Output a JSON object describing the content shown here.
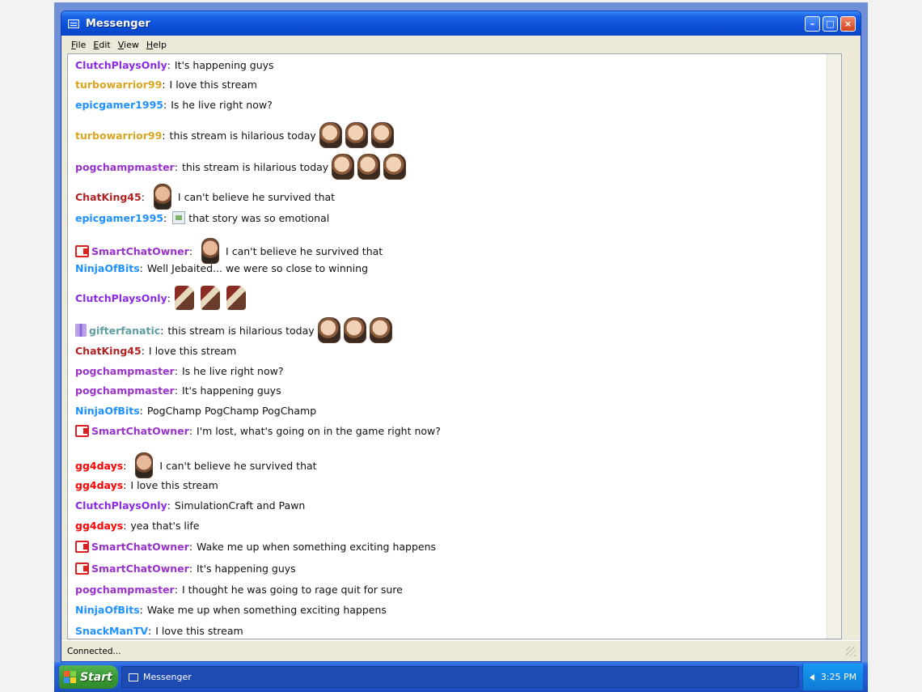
{
  "window": {
    "title": "Messenger"
  },
  "menu": [
    {
      "label": "File",
      "key": "F",
      "rest": "ile"
    },
    {
      "label": "Edit",
      "key": "E",
      "rest": "dit"
    },
    {
      "label": "View",
      "key": "V",
      "rest": "iew"
    },
    {
      "label": "Help",
      "key": "H",
      "rest": "elp"
    }
  ],
  "messages": [
    {
      "user": "ClutchPlaysOnly",
      "color": "#8a2be2",
      "text": "It's happening guys"
    },
    {
      "user": "turbowarrior99",
      "color": "#daa520",
      "text": "I love this stream"
    },
    {
      "user": "epicgamer1995",
      "color": "#1e90ff",
      "text": "Is he live right now?"
    },
    {
      "user": "turbowarrior99",
      "color": "#daa520",
      "text": "this stream is hilarious today",
      "emotes": 3
    },
    {
      "user": "pogchampmaster",
      "color": "#9932cc",
      "text": "this stream is hilarious today",
      "emotes": 3
    },
    {
      "user": "ChatKing45",
      "color": "#b22222",
      "text": "I can't believe he survived that",
      "face": true
    },
    {
      "user": "epicgamer1995",
      "color": "#1e90ff",
      "text": "that story was so emotional",
      "broken_img": true
    },
    {
      "user": "SmartChatOwner",
      "color": "#9932cc",
      "text": "I can't believe he survived that",
      "badge": "cam",
      "face": true
    },
    {
      "user": "NinjaOfBits",
      "color": "#1e90ff",
      "text": "Well Jebaited... we were so close to winning"
    },
    {
      "user": "ClutchPlaysOnly",
      "color": "#8a2be2",
      "text": "",
      "dinos": 3
    },
    {
      "user": "gifterfanatic",
      "color": "#5f9ea0",
      "text": "this stream is hilarious today",
      "badge": "gift",
      "emotes": 3
    },
    {
      "user": "ChatKing45",
      "color": "#b22222",
      "text": "I love this stream"
    },
    {
      "user": "pogchampmaster",
      "color": "#9932cc",
      "text": "Is he live right now?"
    },
    {
      "user": "pogchampmaster",
      "color": "#9932cc",
      "text": "It's happening guys"
    },
    {
      "user": "NinjaOfBits",
      "color": "#1e90ff",
      "text": "PogChamp PogChamp PogChamp"
    },
    {
      "user": "SmartChatOwner",
      "color": "#9932cc",
      "text": "I'm lost, what's going on in the game right now?",
      "badge": "cam"
    },
    {
      "user": "gg4days",
      "color": "#ff0000",
      "text": "I can't believe he survived that",
      "face": true
    },
    {
      "user": "gg4days",
      "color": "#ff0000",
      "text": "I love this stream"
    },
    {
      "user": "ClutchPlaysOnly",
      "color": "#8a2be2",
      "text": "SimulationCraft and Pawn"
    },
    {
      "user": "gg4days",
      "color": "#ff0000",
      "text": "yea that's life"
    },
    {
      "user": "SmartChatOwner",
      "color": "#9932cc",
      "text": "Wake me up when something exciting happens",
      "badge": "cam"
    },
    {
      "user": "SmartChatOwner",
      "color": "#9932cc",
      "text": "It's happening guys",
      "badge": "cam"
    },
    {
      "user": "pogchampmaster",
      "color": "#9932cc",
      "text": "I thought he was going to rage quit for sure"
    },
    {
      "user": "NinjaOfBits",
      "color": "#1e90ff",
      "text": "Wake me up when something exciting happens"
    },
    {
      "user": "SnackManTV",
      "color": "#1e90ff",
      "text": "I love this stream"
    }
  ],
  "status": {
    "text": "Connected..."
  },
  "taskbar": {
    "start_label": "Start",
    "task_label": "Messenger",
    "clock": "3:25 PM"
  }
}
